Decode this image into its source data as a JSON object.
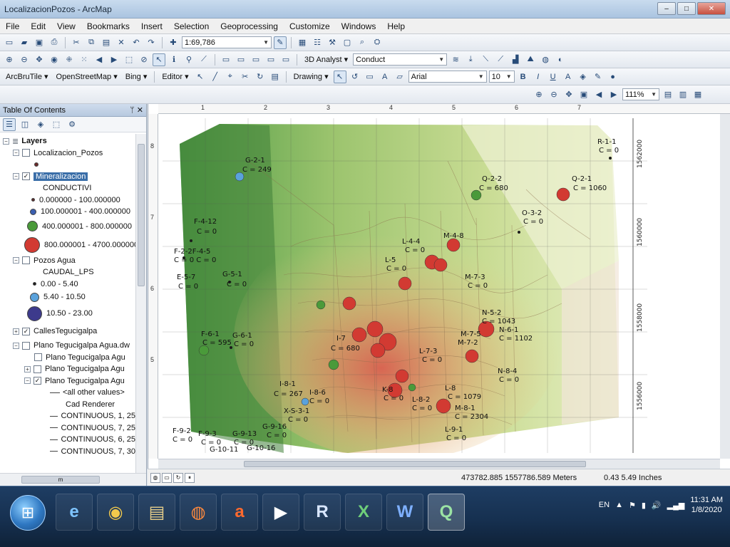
{
  "window": {
    "title": "LocalizacionPozos - ArcMap",
    "controls": [
      "–",
      "□",
      "✕"
    ]
  },
  "menubar": [
    "File",
    "Edit",
    "View",
    "Bookmarks",
    "Insert",
    "Selection",
    "Geoprocessing",
    "Customize",
    "Windows",
    "Help"
  ],
  "toolbar1": {
    "scale": "1:69,786"
  },
  "toolbar2": {
    "analyst_label": "3D Analyst ▾",
    "layer_combo": "Conduct"
  },
  "toolbar3": {
    "basemap1": "ArcBruTile ▾",
    "basemap2": "OpenStreetMap ▾",
    "basemap3": "Bing ▾",
    "editor": "Editor ▾",
    "drawing": "Drawing ▾",
    "font": "Arial",
    "font_size": "10",
    "bold": "B",
    "italic": "I",
    "underline": "U"
  },
  "toolbar4": {
    "zoom": "111%"
  },
  "toc": {
    "title": "Table Of Contents",
    "pin": "ᛘ",
    "close": "✕",
    "root": "Layers",
    "items": [
      {
        "label": "Localizacion_Pozos"
      },
      {
        "label": "Mineralizacion"
      },
      {
        "label": "CONDUCTIVI"
      },
      {
        "label": "0.000000 - 100.000000"
      },
      {
        "label": "100.000001 - 400.000000"
      },
      {
        "label": "400.000001 - 800.000000"
      },
      {
        "label": "800.000001 - 4700.000000"
      },
      {
        "label": "Pozos Agua"
      },
      {
        "label": "CAUDAL_LPS"
      },
      {
        "label": "0.00 - 5.40"
      },
      {
        "label": "5.40 - 10.50"
      },
      {
        "label": "10.50 - 23.00"
      },
      {
        "label": "CallesTegucigalpa"
      },
      {
        "label": "Plano Tegucigalpa Agua.dw"
      },
      {
        "label": "Plano Tegucigalpa Agu"
      },
      {
        "label": "Plano Tegucigalpa Agu"
      },
      {
        "label": "Plano Tegucigalpa Agu"
      },
      {
        "label": "<all other values>"
      },
      {
        "label": "Cad Renderer"
      },
      {
        "label": "CONTINUOUS, 1, 25"
      },
      {
        "label": "CONTINUOUS, 7, 25"
      },
      {
        "label": "CONTINUOUS, 6, 25"
      },
      {
        "label": "CONTINUOUS, 7, 30"
      }
    ],
    "hscroll_label": "m"
  },
  "rulers": {
    "top": [
      "1",
      "2",
      "3",
      "4",
      "5",
      "6",
      "7"
    ],
    "left": [
      "8",
      "7",
      "6",
      "5"
    ]
  },
  "map": {
    "grid_labels_right": [
      "1562000",
      "1560000",
      "1558000",
      "1556000"
    ],
    "colors": {
      "cond_low": "#5b2a2a",
      "cond_mid": "#3b5fb0",
      "cond_high": "#4a9a3a",
      "cond_top": "#d23a32",
      "flow_small": "#1c1c1c",
      "flow_med": "#5aa2dc",
      "flow_large": "#3d3a8c"
    },
    "point_labels": [
      {
        "id": "G-2-1",
        "c": "C = 249"
      },
      {
        "id": "Q-2-2",
        "c": "C = 680"
      },
      {
        "id": "Q-2-1",
        "c": "C = 1060"
      },
      {
        "id": "R-1-1",
        "c": "C = 0"
      },
      {
        "id": "O-3-2",
        "c": "C = 0"
      },
      {
        "id": "F-4-12",
        "c": "C = 0"
      },
      {
        "id": "F-2-2F-4-5",
        "c": "C = 0 C = 0"
      },
      {
        "id": "E-5-7",
        "c": "C = 0"
      },
      {
        "id": "G-5-1",
        "c": "C = 0"
      },
      {
        "id": "M-4-8",
        "c": ""
      },
      {
        "id": "L-4-4",
        "c": "C = 0"
      },
      {
        "id": "L-5",
        "c": "C = 0"
      },
      {
        "id": "M-7-3",
        "c": "C = 0"
      },
      {
        "id": "N-5-2",
        "c": "C = 1043"
      },
      {
        "id": "N-6-1",
        "c": "C = 1102"
      },
      {
        "id": "F-6-1",
        "c": "C = 595"
      },
      {
        "id": "G-6-1",
        "c": "C = 0"
      },
      {
        "id": "I-7",
        "c": "C = 680"
      },
      {
        "id": "M-7-5",
        "c": "C = 0"
      },
      {
        "id": "M-7-2",
        "c": "C = 0"
      },
      {
        "id": "L-7-3",
        "c": "C = 0"
      },
      {
        "id": "N-8-4",
        "c": "C = 0"
      },
      {
        "id": "I-8-1",
        "c": "C = 267"
      },
      {
        "id": "I-8-6",
        "c": "C = 0"
      },
      {
        "id": "K-8",
        "c": "C = 0"
      },
      {
        "id": "L-8-2",
        "c": "C = 0"
      },
      {
        "id": "L-8",
        "c": "C = 1079"
      },
      {
        "id": "M-8-1",
        "c": "C = 2304"
      },
      {
        "id": "X-S-3-1",
        "c": "C = 0"
      },
      {
        "id": "F-9-2",
        "c": "C = 0"
      },
      {
        "id": "F-9-3",
        "c": "C = 0"
      },
      {
        "id": "G-9-13",
        "c": "C = 0"
      },
      {
        "id": "G-9-16",
        "c": "C = 0"
      },
      {
        "id": "G-10-11",
        "c": ""
      },
      {
        "id": "G-10-16",
        "c": ""
      },
      {
        "id": "L-9-1",
        "c": "C = 0"
      }
    ]
  },
  "status": {
    "coords": "473782.885  1557786.589 Meters",
    "page": "0.43  5.49 Inches"
  },
  "taskbar": {
    "apps": [
      "e",
      "◉",
      "▤",
      "◍",
      "a",
      "▶",
      "R",
      "X",
      "W",
      "Q"
    ],
    "lang": "EN",
    "time": "11:31 AM",
    "date": "1/8/2020"
  }
}
